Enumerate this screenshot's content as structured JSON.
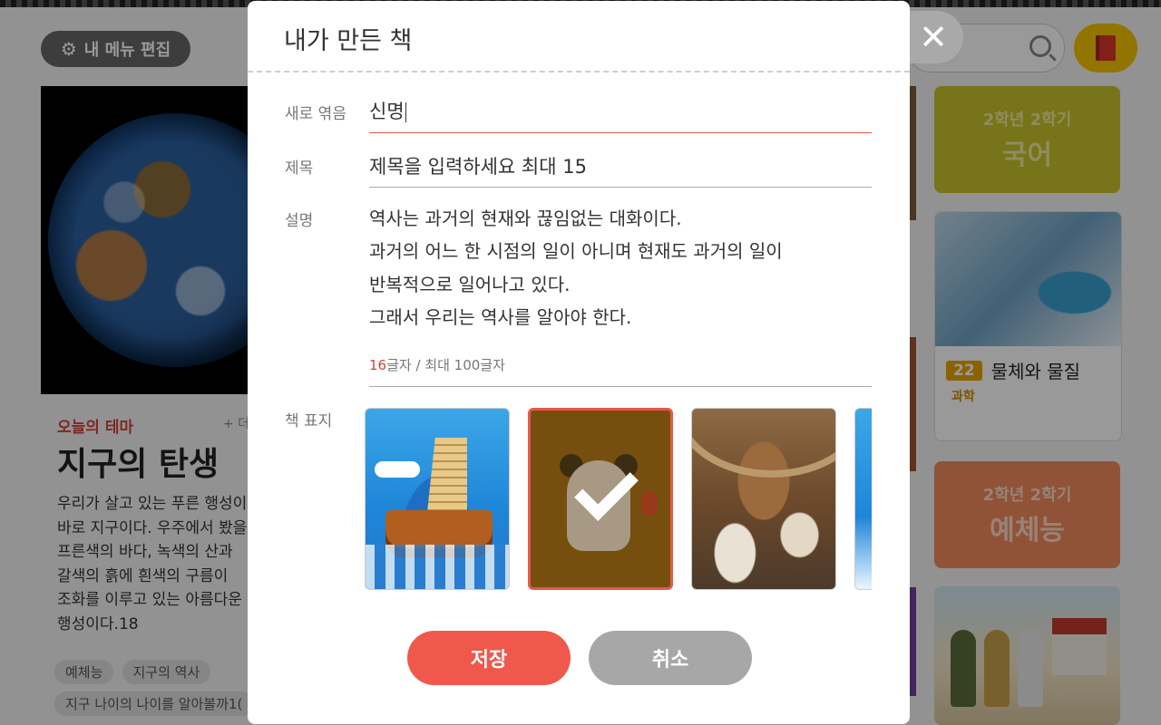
{
  "background": {
    "menu_edit_label": "내 메뉴 편집",
    "theme_label": "오늘의 테마",
    "theme_more": "+ 더",
    "theme_title": "지구의 탄생",
    "theme_desc": "우리가 살고 있는 푸른 행성이\n바로 지구이다. 우주에서 봤을\n프른색의 바다, 녹색의 산과\n갈색의 흙에 흰색의 구름이\n조화를 이루고 있는 아름다운\n행성이다.18",
    "tags": [
      "예체능",
      "지구의 역사",
      "지구 나이의 나이를 알아볼까1("
    ],
    "cards": {
      "korean": {
        "sub": "2학년 2학기",
        "main": "국어"
      },
      "science": {
        "num": "22",
        "title": "물체와 물질",
        "category": "과학"
      },
      "arts": {
        "sub": "2학년 2학기",
        "main": "예체능"
      }
    }
  },
  "modal": {
    "title": "내가 만든 책",
    "close_symbol": "✕",
    "fields": {
      "collection_label": "새로 엮음",
      "collection_value": "신명",
      "title_label": "제목",
      "title_value": "제목을 입력하세요 최대 15",
      "desc_label": "설명",
      "desc_value": "역사는 과거의 현재와 끊임없는 대화이다.\n과거의 어느 한 시점의 일이 아니며 현재도 과거의 일이\n반복적으로 일어나고 있다.\n그래서 우리는 역사를 알아야 한다.",
      "char_count": "16",
      "char_count_suffix": "글자",
      "char_max": "/ 최대 100글자",
      "cover_label": "책 표지"
    },
    "covers": [
      {
        "name": "turtle-ship",
        "selected": false
      },
      {
        "name": "character-reading",
        "selected": true
      },
      {
        "name": "battle-fresco",
        "selected": false
      },
      {
        "name": "sea-partial",
        "selected": false
      }
    ],
    "save_label": "저장",
    "cancel_label": "취소"
  },
  "colors": {
    "accent": "#f0584b",
    "counter_highlight": "#d7423a",
    "cancel": "#a7a7a7"
  }
}
